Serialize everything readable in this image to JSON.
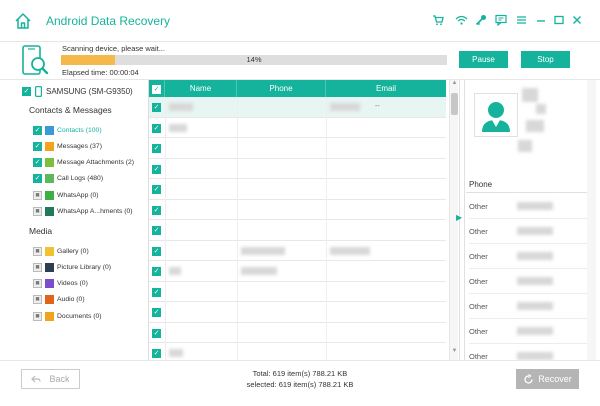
{
  "app": {
    "title": "Android Data Recovery"
  },
  "titlebar": {
    "icons": [
      "cart-icon",
      "wifi-icon",
      "key-icon",
      "feedback-icon",
      "menu-icon",
      "minimize-icon",
      "maximize-icon",
      "close-icon"
    ]
  },
  "scan": {
    "status": "Scanning device, please wait...",
    "progress_percent": 14,
    "progress_label": "14%",
    "elapsed": "Elapsed time: 00:00:04",
    "pause_label": "Pause",
    "stop_label": "Stop"
  },
  "sidebar": {
    "device": "SAMSUNG (SM-G9350)",
    "sections": [
      {
        "title": "Contacts & Messages",
        "items": [
          {
            "label": "Contacts (100)",
            "checked": true,
            "active": true,
            "icon": "contacts-icon",
            "color": "#3a9ad9"
          },
          {
            "label": "Messages (37)",
            "checked": true,
            "active": false,
            "icon": "messages-icon",
            "color": "#f2a31d"
          },
          {
            "label": "Message Attachments (2)",
            "checked": true,
            "active": false,
            "icon": "attachments-icon",
            "color": "#7cbf3d"
          },
          {
            "label": "Call Logs (480)",
            "checked": true,
            "active": false,
            "icon": "call-logs-icon",
            "color": "#5cb85c"
          },
          {
            "label": "WhatsApp (0)",
            "checked": false,
            "active": false,
            "icon": "whatsapp-icon",
            "color": "#3cb043"
          },
          {
            "label": "WhatsApp A...hments (0)",
            "checked": false,
            "active": false,
            "icon": "whatsapp-attachments-icon",
            "color": "#1e7b5b"
          }
        ]
      },
      {
        "title": "Media",
        "items": [
          {
            "label": "Gallery (0)",
            "checked": false,
            "active": false,
            "icon": "gallery-icon",
            "color": "#f2c12e"
          },
          {
            "label": "Picture Library (0)",
            "checked": false,
            "active": false,
            "icon": "picture-library-icon",
            "color": "#2c3e50"
          },
          {
            "label": "Videos (0)",
            "checked": false,
            "active": false,
            "icon": "videos-icon",
            "color": "#7b4fc9"
          },
          {
            "label": "Audio (0)",
            "checked": false,
            "active": false,
            "icon": "audio-icon",
            "color": "#e0651a"
          },
          {
            "label": "Documents (0)",
            "checked": false,
            "active": false,
            "icon": "documents-icon",
            "color": "#f2a31d"
          }
        ]
      }
    ]
  },
  "table": {
    "columns": [
      "Name",
      "Phone",
      "Email"
    ],
    "email_first_row_suffix": "--"
  },
  "detail": {
    "phone_header": "Phone",
    "rows": [
      "Other",
      "Other",
      "Other",
      "Other",
      "Other",
      "Other",
      "Other"
    ]
  },
  "footer": {
    "back_label": "Back",
    "total": "Total: 619 item(s) 788.21 KB",
    "selected": "selected: 619 item(s) 788.21 KB",
    "recover_label": "Recover"
  },
  "colors": {
    "accent": "#15b39b",
    "progress": "#f5b84a"
  }
}
